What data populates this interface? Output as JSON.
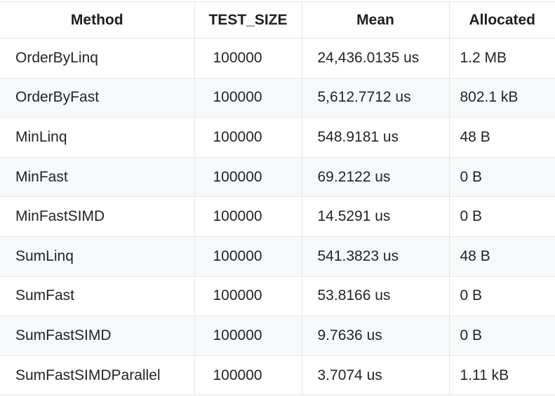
{
  "table": {
    "columns": [
      {
        "key": "method",
        "label": "Method"
      },
      {
        "key": "test_size",
        "label": "TEST_SIZE"
      },
      {
        "key": "mean",
        "label": "Mean"
      },
      {
        "key": "allocated",
        "label": "Allocated"
      }
    ],
    "rows": [
      {
        "method": "OrderByLinq",
        "test_size": "100000",
        "mean": "24,436.0135 us",
        "allocated": "1.2 MB"
      },
      {
        "method": "OrderByFast",
        "test_size": "100000",
        "mean": "5,612.7712 us",
        "allocated": "802.1 kB"
      },
      {
        "method": "MinLinq",
        "test_size": "100000",
        "mean": "548.9181 us",
        "allocated": "48 B"
      },
      {
        "method": "MinFast",
        "test_size": "100000",
        "mean": "69.2122 us",
        "allocated": "0 B"
      },
      {
        "method": "MinFastSIMD",
        "test_size": "100000",
        "mean": "14.5291 us",
        "allocated": "0 B"
      },
      {
        "method": "SumLinq",
        "test_size": "100000",
        "mean": "541.3823 us",
        "allocated": "48 B"
      },
      {
        "method": "SumFast",
        "test_size": "100000",
        "mean": "53.8166 us",
        "allocated": "0 B"
      },
      {
        "method": "SumFastSIMD",
        "test_size": "100000",
        "mean": "9.7636 us",
        "allocated": "0 B"
      },
      {
        "method": "SumFastSIMDParallel",
        "test_size": "100000",
        "mean": "3.7074 us",
        "allocated": "1.11 kB"
      }
    ]
  },
  "colors": {
    "text": "#212529",
    "header_text": "#1b1f23",
    "background": "#ffffff",
    "stripe": "#f7f8f9",
    "border": "#dee2e6"
  },
  "chart_data": {
    "type": "table",
    "title": "",
    "columns": [
      "Method",
      "TEST_SIZE",
      "Mean",
      "Allocated"
    ],
    "categories": [
      "OrderByLinq",
      "OrderByFast",
      "MinLinq",
      "MinFast",
      "MinFastSIMD",
      "SumLinq",
      "SumFast",
      "SumFastSIMD",
      "SumFastSIMDParallel"
    ],
    "series": [
      {
        "name": "TEST_SIZE",
        "values": [
          100000,
          100000,
          100000,
          100000,
          100000,
          100000,
          100000,
          100000,
          100000
        ]
      },
      {
        "name": "Mean",
        "unit": "us",
        "values": [
          24436.0135,
          5612.7712,
          548.9181,
          69.2122,
          14.5291,
          541.3823,
          53.8166,
          9.7636,
          3.7074
        ]
      },
      {
        "name": "Allocated",
        "values": [
          "1.2 MB",
          "802.1 kB",
          "48 B",
          "0 B",
          "0 B",
          "48 B",
          "0 B",
          "0 B",
          "1.11 kB"
        ]
      }
    ]
  }
}
